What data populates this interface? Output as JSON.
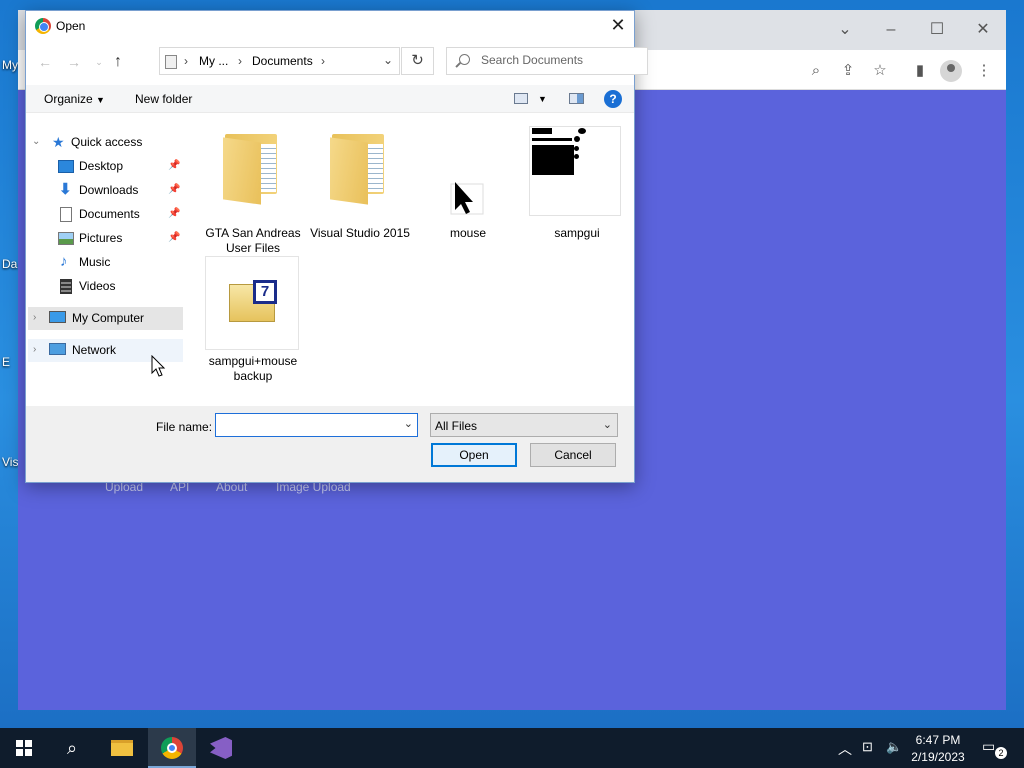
{
  "desktop": {
    "icon_labels": [
      "My",
      "Da",
      "E",
      "Vis"
    ]
  },
  "browser": {
    "footer_links": [
      "Upload",
      "API",
      "About",
      "Image Upload"
    ]
  },
  "dialog": {
    "title": "Open",
    "address": {
      "segments": [
        "My ...",
        "Documents"
      ]
    },
    "search_placeholder": "Search Documents",
    "commands": {
      "organize": "Organize",
      "new_folder": "New folder",
      "help": "?"
    },
    "nav": {
      "quick_access": "Quick access",
      "quick_items": [
        {
          "label": "Desktop",
          "pinned": true
        },
        {
          "label": "Downloads",
          "pinned": true
        },
        {
          "label": "Documents",
          "pinned": true
        },
        {
          "label": "Pictures",
          "pinned": true
        },
        {
          "label": "Music",
          "pinned": false
        },
        {
          "label": "Videos",
          "pinned": false
        }
      ],
      "my_computer": "My Computer",
      "network": "Network"
    },
    "files": [
      {
        "name": "GTA San Andreas User Files",
        "type": "folder"
      },
      {
        "name": "Visual Studio 2015",
        "type": "folder"
      },
      {
        "name": "mouse",
        "type": "image"
      },
      {
        "name": "sampgui",
        "type": "image"
      },
      {
        "name": "sampgui+mouse backup",
        "type": "archive"
      }
    ],
    "file_name_label": "File name:",
    "file_name_value": "",
    "filter_value": "All Files",
    "open_button": "Open",
    "cancel_button": "Cancel"
  },
  "taskbar": {
    "time": "6:47 PM",
    "date": "2/19/2023",
    "notification_count": "2"
  }
}
